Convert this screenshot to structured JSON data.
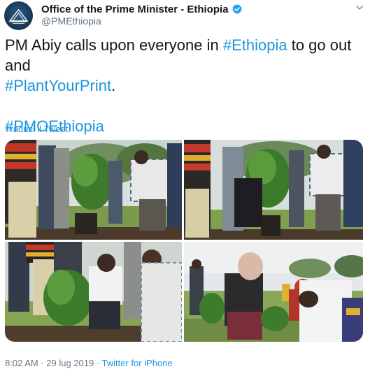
{
  "author": {
    "display_name": "Office of the Prime Minister - Ethiopia",
    "handle": "@PMEthiopia",
    "avatar_icon": "pmo-emblem-avatar",
    "verified_icon": "verified-badge-icon",
    "verified_color": "#1da1f2"
  },
  "tweet": {
    "line1_prefix": "PM Abiy calls upon everyone in ",
    "hashtag_ethiopia": "#Ethiopia",
    "line1_suffix": " to go out and",
    "hashtag_plant": "#PlantYourPrint",
    "line2_suffix": ".",
    "hashtag_pmo": "#PMOEthiopia",
    "link_color": "#1b95e0"
  },
  "translate_label": "Traduci il Tweet",
  "media": [
    {
      "description_icon": "photo-tree-planting-1"
    },
    {
      "description_icon": "photo-tree-planting-2"
    },
    {
      "description_icon": "photo-tree-planting-3"
    },
    {
      "description_icon": "photo-tree-planting-4"
    }
  ],
  "meta": {
    "time": "8:02 AM",
    "separator1": " · ",
    "date": "29 lug 2019",
    "separator2": " · ",
    "source": "Twitter for iPhone"
  },
  "menu_icon": "chevron-down-icon"
}
